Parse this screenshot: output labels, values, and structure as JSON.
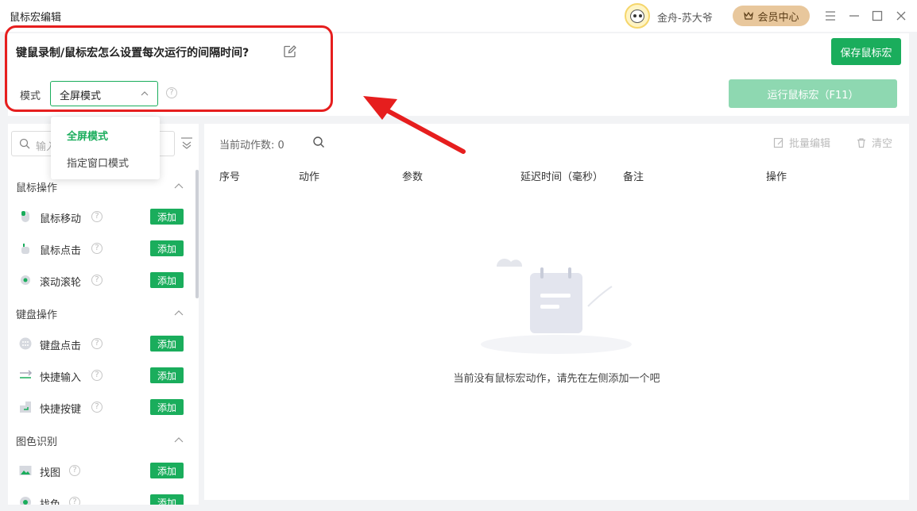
{
  "app": {
    "title": "鼠标宏编辑"
  },
  "user": {
    "name": "金舟-苏大爷",
    "vip_label": "会员中心"
  },
  "header": {
    "macro_title": "键鼠录制/鼠标宏怎么设置每次运行的间隔时间?",
    "save_label": "保存鼠标宏",
    "mode_label": "模式",
    "mode_value": "全屏模式",
    "run_label": "运行鼠标宏（F11）"
  },
  "dropdown": {
    "options": [
      "全屏模式",
      "指定窗口模式"
    ]
  },
  "sidebar": {
    "search_placeholder": "输入",
    "categories": [
      {
        "title": "鼠标操作",
        "items": [
          {
            "label": "鼠标移动",
            "icon": "mouse-move-icon",
            "add": "添加"
          },
          {
            "label": "鼠标点击",
            "icon": "mouse-click-icon",
            "add": "添加"
          },
          {
            "label": "滚动滚轮",
            "icon": "scroll-wheel-icon",
            "add": "添加"
          }
        ]
      },
      {
        "title": "键盘操作",
        "items": [
          {
            "label": "键盘点击",
            "icon": "keyboard-icon",
            "add": "添加"
          },
          {
            "label": "快捷输入",
            "icon": "quick-input-icon",
            "add": "添加"
          },
          {
            "label": "快捷按键",
            "icon": "shortcut-key-icon",
            "add": "添加"
          }
        ]
      },
      {
        "title": "图色识别",
        "items": [
          {
            "label": "找图",
            "icon": "find-image-icon",
            "add": "添加"
          },
          {
            "label": "找色",
            "icon": "find-color-icon",
            "add": "添加"
          }
        ]
      }
    ]
  },
  "main": {
    "count_label": "当前动作数: 0",
    "batch_edit": "批量编辑",
    "clear": "清空",
    "columns": [
      "序号",
      "动作",
      "参数",
      "延迟时间（毫秒）",
      "备注",
      "操作"
    ],
    "empty_text": "当前没有鼠标宏动作，请先在左侧添加一个吧"
  },
  "colors": {
    "accent": "#1aad5c",
    "run_disabled": "#8ed8b1",
    "highlight": "#e61e1e",
    "vip": "#e8c79c"
  }
}
